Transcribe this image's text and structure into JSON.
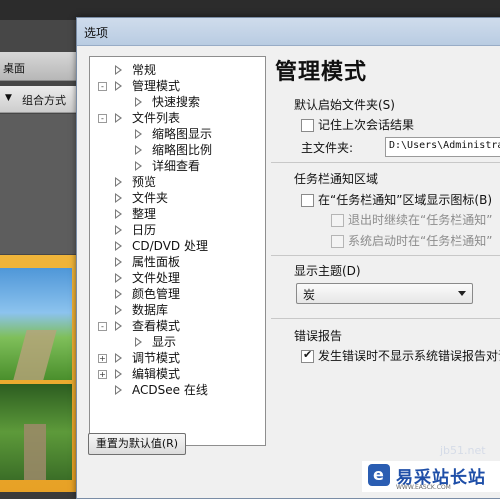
{
  "background": {
    "toolbar_label": "桌面",
    "sort_label": "组合方式"
  },
  "dialog": {
    "title": "选项",
    "reset_button": "重置为默认值(R)",
    "tree": [
      {
        "label": "常规",
        "level": 0,
        "expander": "",
        "icon": "triangle"
      },
      {
        "label": "管理模式",
        "level": 0,
        "expander": "-",
        "icon": "triangle"
      },
      {
        "label": "快速搜索",
        "level": 1,
        "expander": "",
        "icon": "triangle"
      },
      {
        "label": "文件列表",
        "level": 0,
        "expander": "-",
        "icon": "triangle"
      },
      {
        "label": "缩略图显示",
        "level": 1,
        "expander": "",
        "icon": "triangle"
      },
      {
        "label": "缩略图比例",
        "level": 1,
        "expander": "",
        "icon": "triangle"
      },
      {
        "label": "详细查看",
        "level": 1,
        "expander": "",
        "icon": "triangle"
      },
      {
        "label": "预览",
        "level": 0,
        "expander": "",
        "icon": "triangle"
      },
      {
        "label": "文件夹",
        "level": 0,
        "expander": "",
        "icon": "triangle"
      },
      {
        "label": "整理",
        "level": 0,
        "expander": "",
        "icon": "triangle"
      },
      {
        "label": "日历",
        "level": 0,
        "expander": "",
        "icon": "triangle"
      },
      {
        "label": "CD/DVD 处理",
        "level": 0,
        "expander": "",
        "icon": "triangle"
      },
      {
        "label": "属性面板",
        "level": 0,
        "expander": "",
        "icon": "triangle"
      },
      {
        "label": "文件处理",
        "level": 0,
        "expander": "",
        "icon": "triangle"
      },
      {
        "label": "颜色管理",
        "level": 0,
        "expander": "",
        "icon": "triangle"
      },
      {
        "label": "数据库",
        "level": 0,
        "expander": "",
        "icon": "triangle"
      },
      {
        "label": "查看模式",
        "level": 0,
        "expander": "-",
        "icon": "triangle"
      },
      {
        "label": "显示",
        "level": 1,
        "expander": "",
        "icon": "triangle"
      },
      {
        "label": "调节模式",
        "level": 0,
        "expander": "+",
        "icon": "triangle"
      },
      {
        "label": "编辑模式",
        "level": 0,
        "expander": "+",
        "icon": "triangle"
      },
      {
        "label": "ACDSee 在线",
        "level": 0,
        "expander": "",
        "icon": "triangle"
      }
    ],
    "page": {
      "title": "管理模式",
      "startup_section": {
        "label": "默认启始文件夹(S)",
        "remember_session": {
          "label": "记住上次会话结果",
          "checked": false
        },
        "main_folder_label": "主文件夹:",
        "main_folder_value": "D:\\Users\\Administrator"
      },
      "taskbar_section": {
        "label": "任务栏通知区域",
        "show_icon": {
          "label": "在“任务栏通知”区域显示图标(B)",
          "checked": false
        },
        "continue_on_exit": {
          "label": "退出时继续在“任务栏通知”",
          "checked": false,
          "disabled": true
        },
        "start_on_boot": {
          "label": "系统启动时在“任务栏通知”",
          "checked": false,
          "disabled": true
        }
      },
      "theme_section": {
        "label": "显示主题(D)",
        "selected": "炭"
      },
      "error_section": {
        "label": "错误报告",
        "suppress_report": {
          "label": "发生错误时不显示系统错误报告对话框",
          "checked": true
        }
      }
    }
  },
  "watermark": {
    "top_text": "jb51.net",
    "name": "易采站长站",
    "url": "WWW.EASCK.COM"
  }
}
